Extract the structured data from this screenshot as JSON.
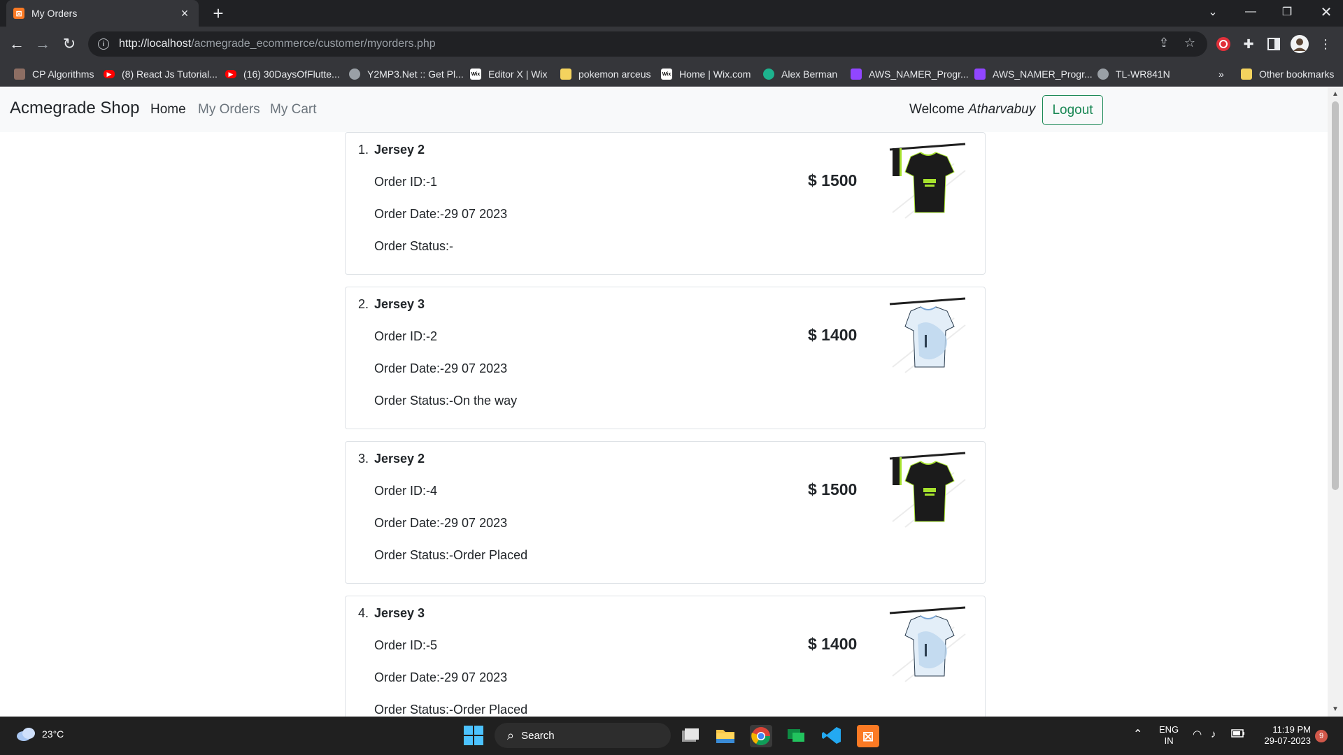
{
  "browser": {
    "tab_title": "My Orders",
    "tab_favicon": "xampp-icon",
    "url_host": "http://localhost",
    "url_path": "/acmegrade_ecommerce/customer/myorders.php",
    "bookmarks": [
      {
        "label": "CP Algorithms",
        "icon": "cp-algorithms-icon",
        "color": "#8d6e63"
      },
      {
        "label": "(8) React Js Tutorial...",
        "icon": "youtube-icon",
        "color": "#ff0000"
      },
      {
        "label": "(16) 30DaysOfFlutte...",
        "icon": "youtube-icon",
        "color": "#ff0000"
      },
      {
        "label": "Y2MP3.Net :: Get Pl...",
        "icon": "globe-icon",
        "color": "#9aa0a6"
      },
      {
        "label": "Editor X | Wix",
        "icon": "wix-icon",
        "color": "#ffffff"
      },
      {
        "label": "pokemon arceus",
        "icon": "folder-icon",
        "color": "#f4d35e"
      },
      {
        "label": "Home | Wix.com",
        "icon": "wix-icon",
        "color": "#ffffff"
      },
      {
        "label": "Alex Berman",
        "icon": "teal-circle-icon",
        "color": "#1db38e"
      },
      {
        "label": "AWS_NAMER_Progr...",
        "icon": "twitch-icon",
        "color": "#9146ff"
      },
      {
        "label": "AWS_NAMER_Progr...",
        "icon": "twitch-icon",
        "color": "#9146ff"
      },
      {
        "label": "TL-WR841N",
        "icon": "globe-icon",
        "color": "#9aa0a6"
      }
    ],
    "overflow_label": "»",
    "other_bookmarks": "Other bookmarks"
  },
  "page": {
    "brand": "Acmegrade Shop",
    "nav": [
      {
        "label": "Home",
        "active": true
      },
      {
        "label": "My Orders",
        "active": false
      },
      {
        "label": "My Cart",
        "active": false
      }
    ],
    "welcome_prefix": "Welcome",
    "username": "Atharvabuy",
    "logout_label": "Logout",
    "orders": [
      {
        "num": "1.",
        "name": "Jersey 2",
        "order_id": "Order ID:-1",
        "order_date": "Order Date:-29 07 2023",
        "order_status": "Order Status:-",
        "price": "$ 1500",
        "jersey": "dark"
      },
      {
        "num": "2.",
        "name": "Jersey 3",
        "order_id": "Order ID:-2",
        "order_date": "Order Date:-29 07 2023",
        "order_status": "Order Status:-On the way",
        "price": "$ 1400",
        "jersey": "light"
      },
      {
        "num": "3.",
        "name": "Jersey 2",
        "order_id": "Order ID:-4",
        "order_date": "Order Date:-29 07 2023",
        "order_status": "Order Status:-Order Placed",
        "price": "$ 1500",
        "jersey": "dark"
      },
      {
        "num": "4.",
        "name": "Jersey 3",
        "order_id": "Order ID:-5",
        "order_date": "Order Date:-29 07 2023",
        "order_status": "Order Status:-Order Placed",
        "price": "$ 1400",
        "jersey": "light"
      }
    ]
  },
  "taskbar": {
    "weather": "23°C",
    "search_label": "Search",
    "lang_top": "ENG",
    "lang_bottom": "IN",
    "time": "11:19 PM",
    "date": "29-07-2023",
    "notification_count": "9"
  },
  "colors": {
    "outline_success": "#198754",
    "navbar_bg": "#f8f9fa",
    "card_border": "#dee2e6",
    "nav_muted": "#6c757d"
  }
}
